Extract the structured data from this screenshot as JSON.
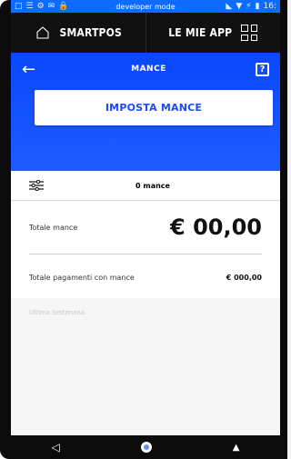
{
  "statusbar": {
    "center": "developer mode",
    "left_icons": [
      "□",
      "☰",
      "⚙",
      "✉",
      "🔒"
    ],
    "right_icons": [
      "◣",
      "▼",
      "⚡",
      "▮"
    ],
    "time": "16:"
  },
  "topnav": {
    "left_label": "SMARTPOS",
    "right_label": "LE MIE APP"
  },
  "header": {
    "title": "MANCE",
    "back_icon": "←",
    "help_icon": "?",
    "cta_label": "IMPOSTA MANCE"
  },
  "filter": {
    "count_label": "0 mance"
  },
  "summary": {
    "total_label": "Totale mance",
    "total_value": "€ 00,00",
    "payments_label": "Totale pagamenti con mance",
    "payments_value": "€ 000,00"
  },
  "section": {
    "week_label": "Ultima Settimana"
  },
  "navbar": {
    "back": "◁",
    "home": "",
    "user": "▲"
  }
}
